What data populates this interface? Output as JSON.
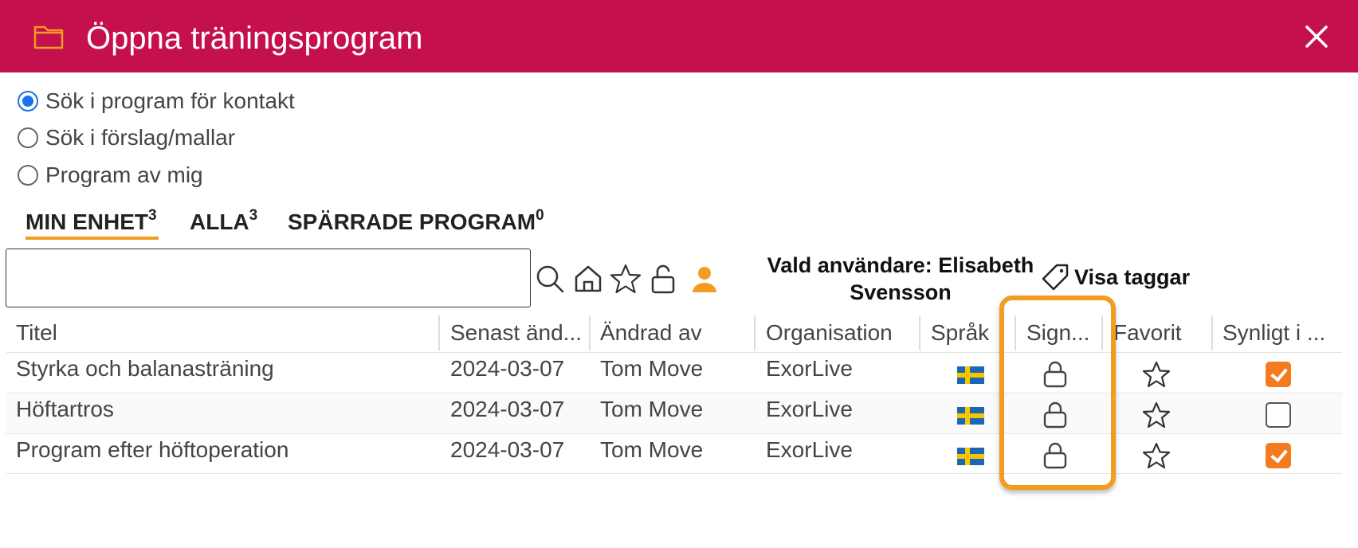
{
  "window": {
    "title": "Öppna träningsprogram",
    "header_color": "#c4114d",
    "accent_color": "#f39c1f"
  },
  "search_options": [
    {
      "label": "Sök i program för kontakt",
      "selected": true
    },
    {
      "label": "Sök i förslag/mallar",
      "selected": false
    },
    {
      "label": "Program av mig",
      "selected": false
    }
  ],
  "tabs": [
    {
      "label": "MIN ENHET",
      "count": "3",
      "active": true
    },
    {
      "label": "ALLA",
      "count": "3",
      "active": false
    },
    {
      "label": "SPÄRRADE PROGRAM",
      "count": "0",
      "active": false
    }
  ],
  "toolbar": {
    "search_value": "",
    "selected_user_text": "Vald användare: Elisabeth Svensson",
    "show_tags_label": "Visa taggar",
    "icons": [
      "search-icon",
      "home-icon",
      "star-icon",
      "unlock-icon",
      "user-icon"
    ]
  },
  "table": {
    "columns": [
      "Titel",
      "Senast änd...",
      "Ändrad av",
      "Organisation",
      "Språk",
      "Sign...",
      "Favorit",
      "Synligt i ..."
    ],
    "rows": [
      {
        "title": "Styrka och balanasträning",
        "modified": "2024-03-07",
        "modified_by": "Tom Move",
        "organisation": "ExorLive",
        "language": "sv-flag",
        "signed": "lock-icon",
        "favorite": false,
        "visible": true
      },
      {
        "title": "Höftartros",
        "modified": "2024-03-07",
        "modified_by": "Tom Move",
        "organisation": "ExorLive",
        "language": "sv-flag",
        "signed": "lock-icon",
        "favorite": false,
        "visible": false
      },
      {
        "title": "Program efter höftoperation",
        "modified": "2024-03-07",
        "modified_by": "Tom Move",
        "organisation": "ExorLive",
        "language": "sv-flag",
        "signed": "lock-icon",
        "favorite": false,
        "visible": true
      }
    ]
  }
}
